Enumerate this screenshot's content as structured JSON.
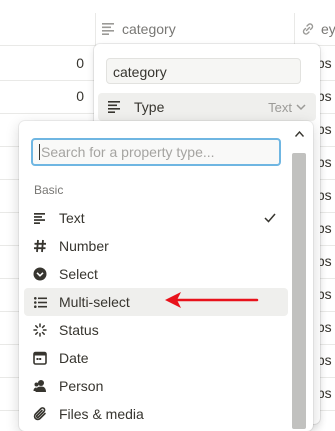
{
  "table": {
    "columns": [
      {
        "name": "col-unnamed",
        "label": ""
      },
      {
        "name": "col-category",
        "label": "category"
      },
      {
        "name": "col-eye",
        "label": "ey"
      }
    ],
    "numbers": [
      "0",
      "0"
    ],
    "url_fragment": "tps"
  },
  "property_panel": {
    "name_value": "category",
    "type_label": "Type",
    "type_value": "Text"
  },
  "type_menu": {
    "search_placeholder": "Search for a property type...",
    "section": "Basic",
    "options": [
      {
        "label": "Text",
        "icon": "text-lines-icon",
        "selected": true
      },
      {
        "label": "Number",
        "icon": "hash-icon",
        "selected": false
      },
      {
        "label": "Select",
        "icon": "select-chevron-circle-icon",
        "selected": false
      },
      {
        "label": "Multi-select",
        "icon": "bullet-list-icon",
        "selected": false,
        "hovered": true
      },
      {
        "label": "Status",
        "icon": "status-spinner-icon",
        "selected": false
      },
      {
        "label": "Date",
        "icon": "calendar-icon",
        "selected": false
      },
      {
        "label": "Person",
        "icon": "person-icon",
        "selected": false
      },
      {
        "label": "Files & media",
        "icon": "paperclip-icon",
        "selected": false
      }
    ]
  },
  "annotation": {
    "arrow_color": "#e8121b"
  }
}
